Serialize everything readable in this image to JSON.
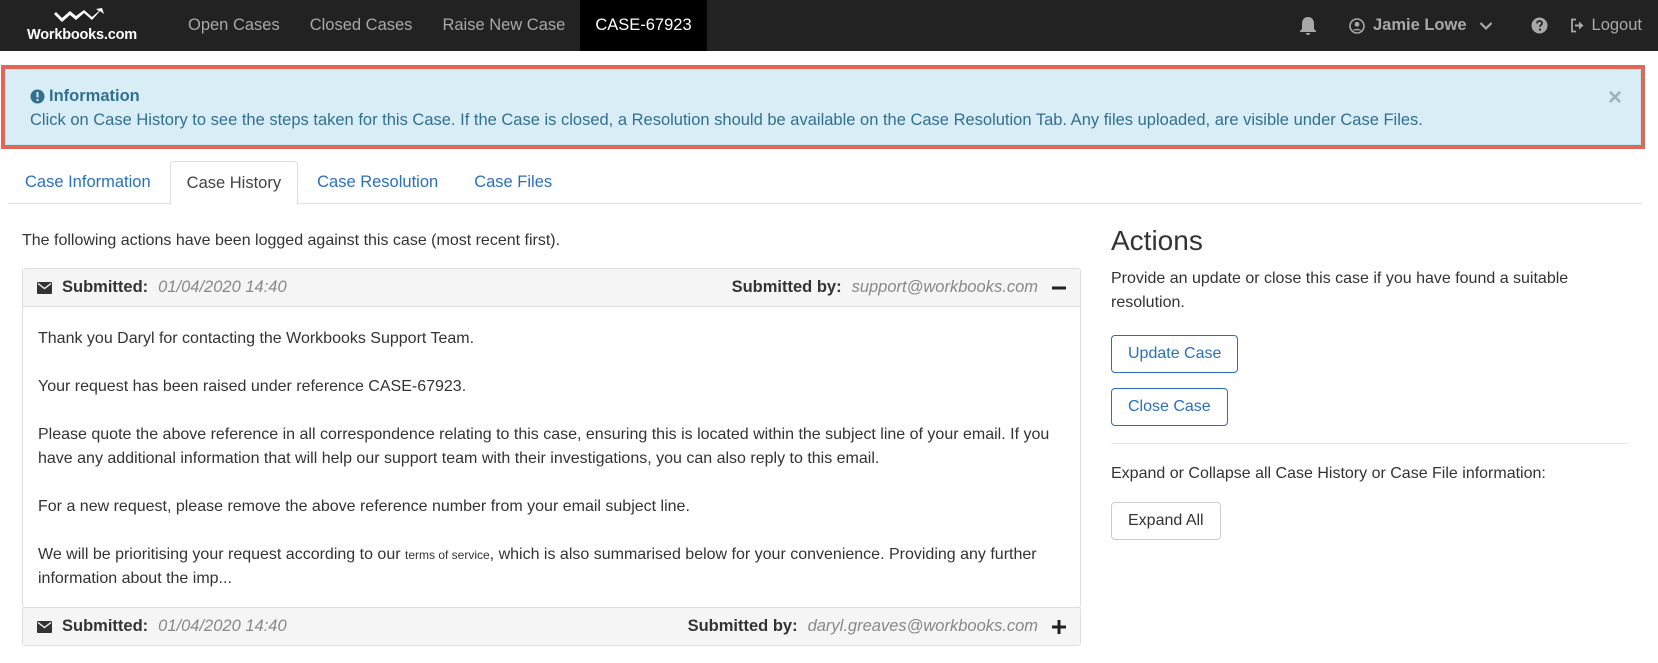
{
  "navbar": {
    "brand": "Workbooks.com",
    "items": [
      {
        "label": "Open Cases"
      },
      {
        "label": "Closed Cases"
      },
      {
        "label": "Raise New Case"
      },
      {
        "label": "CASE-67923"
      }
    ],
    "user_name": "Jamie Lowe",
    "logout_label": "Logout"
  },
  "info": {
    "title": "Information",
    "text": "Click on Case History to see the steps taken for this Case. If the Case is closed, a Resolution should be available on the Case Resolution Tab. Any files uploaded, are visible under Case Files.",
    "close_symbol": "×"
  },
  "tabs": [
    {
      "label": "Case Information"
    },
    {
      "label": "Case History"
    },
    {
      "label": "Case Resolution"
    },
    {
      "label": "Case Files"
    }
  ],
  "history": {
    "lead": "The following actions have been logged against this case (most recent first).",
    "submitted_label": "Submitted:",
    "submitted_by_label": "Submitted by:",
    "entries": [
      {
        "date": "01/04/2020 14:40",
        "by": "support@workbooks.com",
        "toggle": "minus",
        "p1": "Thank you Daryl for contacting the Workbooks Support Team.",
        "p2": "Your request has been raised under reference CASE-67923.",
        "p3": "Please quote the above reference in all correspondence relating to this case, ensuring this is located within the subject line of your email. If you have any additional information that will help our support team with their investigations, you can also reply to this email.",
        "p4": "For a new request, please remove the above reference number from your email subject line.",
        "p5_before": "We will be prioritising your request according to our ",
        "p5_small": "terms of service",
        "p5_after": ", which is also summarised below for your convenience. Providing any further information about the imp..."
      },
      {
        "date": "01/04/2020 14:40",
        "by": "daryl.greaves@workbooks.com",
        "toggle": "plus"
      }
    ]
  },
  "actions": {
    "title": "Actions",
    "description": "Provide an update or close this case if you have found a suitable resolution.",
    "update_label": "Update Case",
    "close_label": "Close Case",
    "expand_text": "Expand or Collapse all Case History or Case File information:",
    "expand_label": "Expand All"
  },
  "colors": {
    "navbar": "#222222",
    "accent": "#2a6fbf",
    "info_bg": "#d9edf7",
    "info_text": "#31708f",
    "highlight": "#e06656"
  }
}
